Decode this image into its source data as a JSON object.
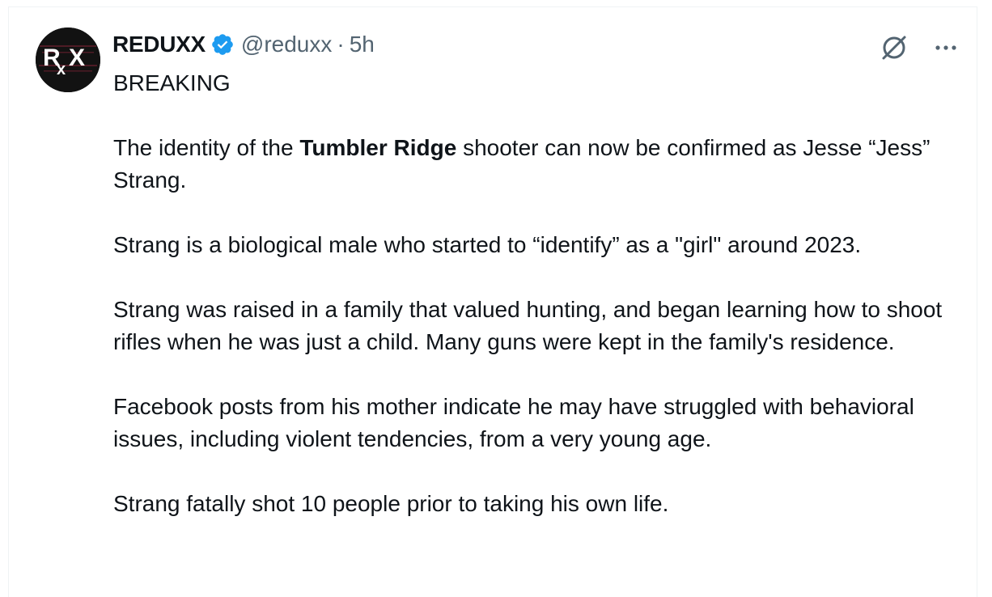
{
  "author": {
    "display_name": "REDUXX",
    "handle": "@reduxx",
    "separator": "·",
    "time": "5h",
    "verified_icon": "verified-badge-icon",
    "avatar_text": "RxX"
  },
  "actions": {
    "grok_icon": "grok-icon",
    "more_icon": "more-icon"
  },
  "tweet": {
    "p1": "BREAKING",
    "p2_pre": "The identity of the ",
    "p2_bold": "Tumbler Ridge",
    "p2_post": " shooter can now be confirmed as Jesse “Jess” Strang.",
    "p3": "Strang is a biological male who started to “identify” as a \"girl\" around 2023.",
    "p4": "Strang was raised in a family that valued hunting, and began learning how to shoot rifles when he was just a child. Many guns were kept in the family's residence.",
    "p5": "Facebook posts from his mother indicate he may have struggled with behavioral issues, including violent tendencies, from a very young age.",
    "p6": "Strang fatally shot 10 people prior to taking his own life."
  },
  "colors": {
    "text": "#0f1419",
    "secondary": "#536471",
    "verified": "#1d9bf0"
  }
}
